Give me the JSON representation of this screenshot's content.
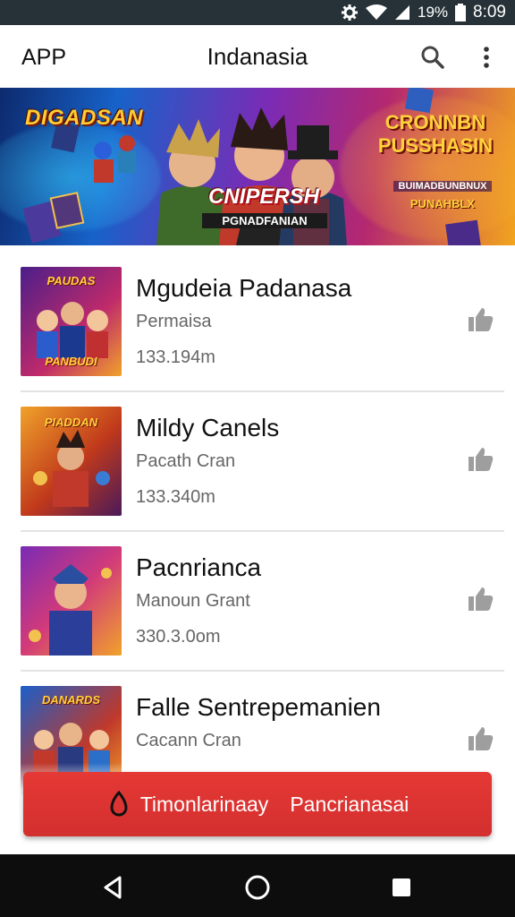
{
  "status_bar": {
    "battery_text": "19%",
    "time": "8:09",
    "icons": [
      "gear-icon",
      "wifi-icon",
      "signal-icon",
      "battery-icon"
    ]
  },
  "app_bar": {
    "app_name": "APP",
    "title": "Indanasia",
    "icons": [
      "search-icon",
      "more-vert-icon"
    ]
  },
  "banner": {
    "left_title": "DIGADSAN",
    "center_title": "CNIPERSH",
    "center_subtitle": "PGNADFANIAN",
    "right_title": "CRONNBN PUSSHASIN",
    "right_tag": "BUIMADBUNBNUX",
    "right_tag2": "PUNAHBLX"
  },
  "list": {
    "items": [
      {
        "thumb_label_top": "PAUDAS",
        "thumb_label_bottom": "PANBUDI",
        "title": "Mgudeia Padanasa",
        "subtitle": "Permaisa",
        "size": "133.194m",
        "action_icon": "thumb-up-icon"
      },
      {
        "thumb_label_top": "PIADDAN",
        "thumb_label_bottom": "",
        "title": "Mildy Canels",
        "subtitle": "Pacath Cran",
        "size": "133.340m",
        "action_icon": "thumb-up-icon"
      },
      {
        "thumb_label_top": "",
        "thumb_label_bottom": "",
        "title": "Pacnrianca",
        "subtitle": "Manoun Grant",
        "size": "330.3.0om",
        "action_icon": "thumb-up-icon"
      },
      {
        "thumb_label_top": "DANARDS",
        "thumb_label_bottom": "",
        "title": "Falle Sentrepemanien",
        "subtitle": "Cacann Cran",
        "size": "",
        "action_icon": "thumb-up-icon"
      }
    ]
  },
  "cta": {
    "label_left": "Timonlarinaay",
    "label_right": "Pancrianasai",
    "icon": "flame-icon"
  },
  "nav_bar": {
    "icons": [
      "back-icon",
      "home-icon",
      "recents-icon"
    ]
  },
  "colors": {
    "status_bar": "#263238",
    "accent": "#d32f2f",
    "nav_bar": "#0d0d0d"
  }
}
